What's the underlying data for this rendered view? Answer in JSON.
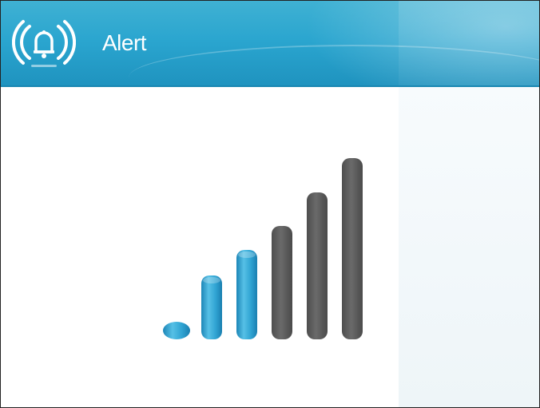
{
  "window": {
    "title": "Alert",
    "logo_icon": "alarm-bell-icon"
  },
  "signal_indicator": {
    "icon": "signal-strength-icon",
    "total_bars": 6,
    "active_bars": 3,
    "active_color": "#2f9fcf",
    "inactive_color": "#5f5f5f"
  },
  "colors": {
    "header_blue": "#2aa5cf",
    "header_text": "#ffffff",
    "background": "#ffffff"
  }
}
